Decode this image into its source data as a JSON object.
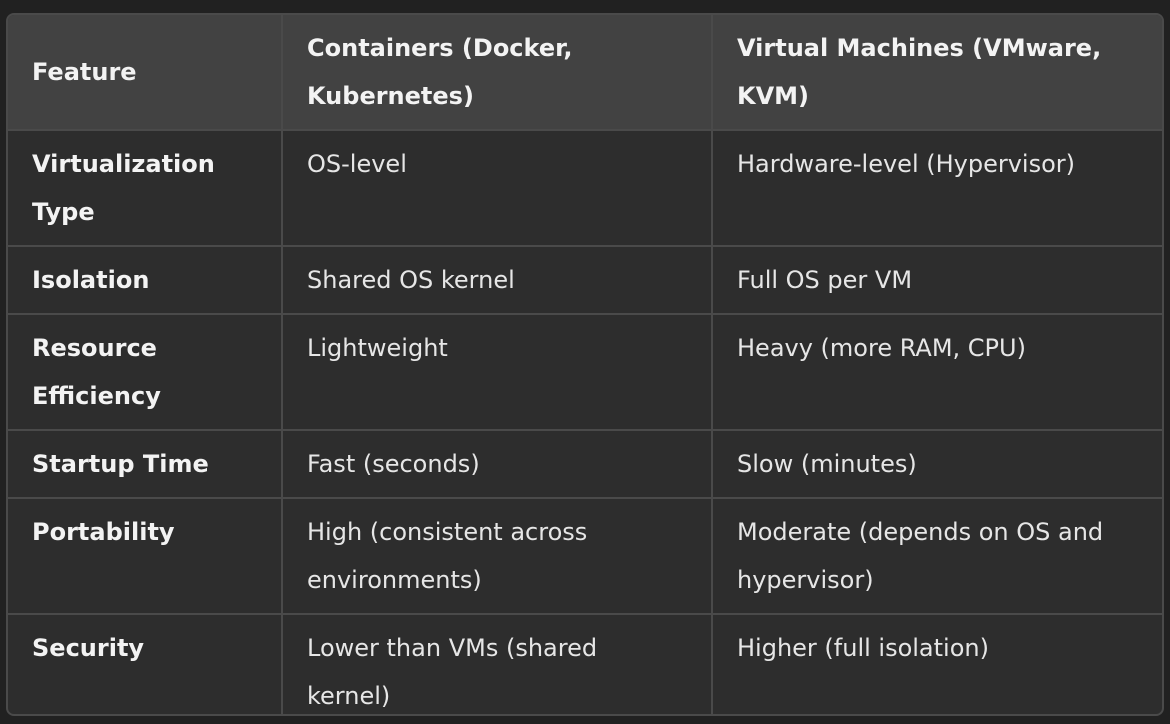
{
  "table": {
    "headers": [
      "Feature",
      "Containers (Docker, Kubernetes)",
      "Virtual Machines (VMware, KVM)"
    ],
    "rows": [
      [
        "Virtualization Type",
        "OS-level",
        "Hardware-level (Hypervisor)"
      ],
      [
        "Isolation",
        "Shared OS kernel",
        "Full OS per VM"
      ],
      [
        "Resource Efficiency",
        "Lightweight",
        "Heavy (more RAM, CPU)"
      ],
      [
        "Startup Time",
        "Fast (seconds)",
        "Slow (minutes)"
      ],
      [
        "Portability",
        "High (consistent across environments)",
        "Moderate (depends on OS and hypervisor)"
      ],
      [
        "Security",
        "Lower than VMs (shared kernel)",
        "Higher (full isolation)"
      ]
    ]
  },
  "colors": {
    "page_background": "#212121",
    "header_background": "#424242",
    "body_background": "#2d2d2d",
    "border": "#4a4a4a",
    "text": "#ececec"
  }
}
